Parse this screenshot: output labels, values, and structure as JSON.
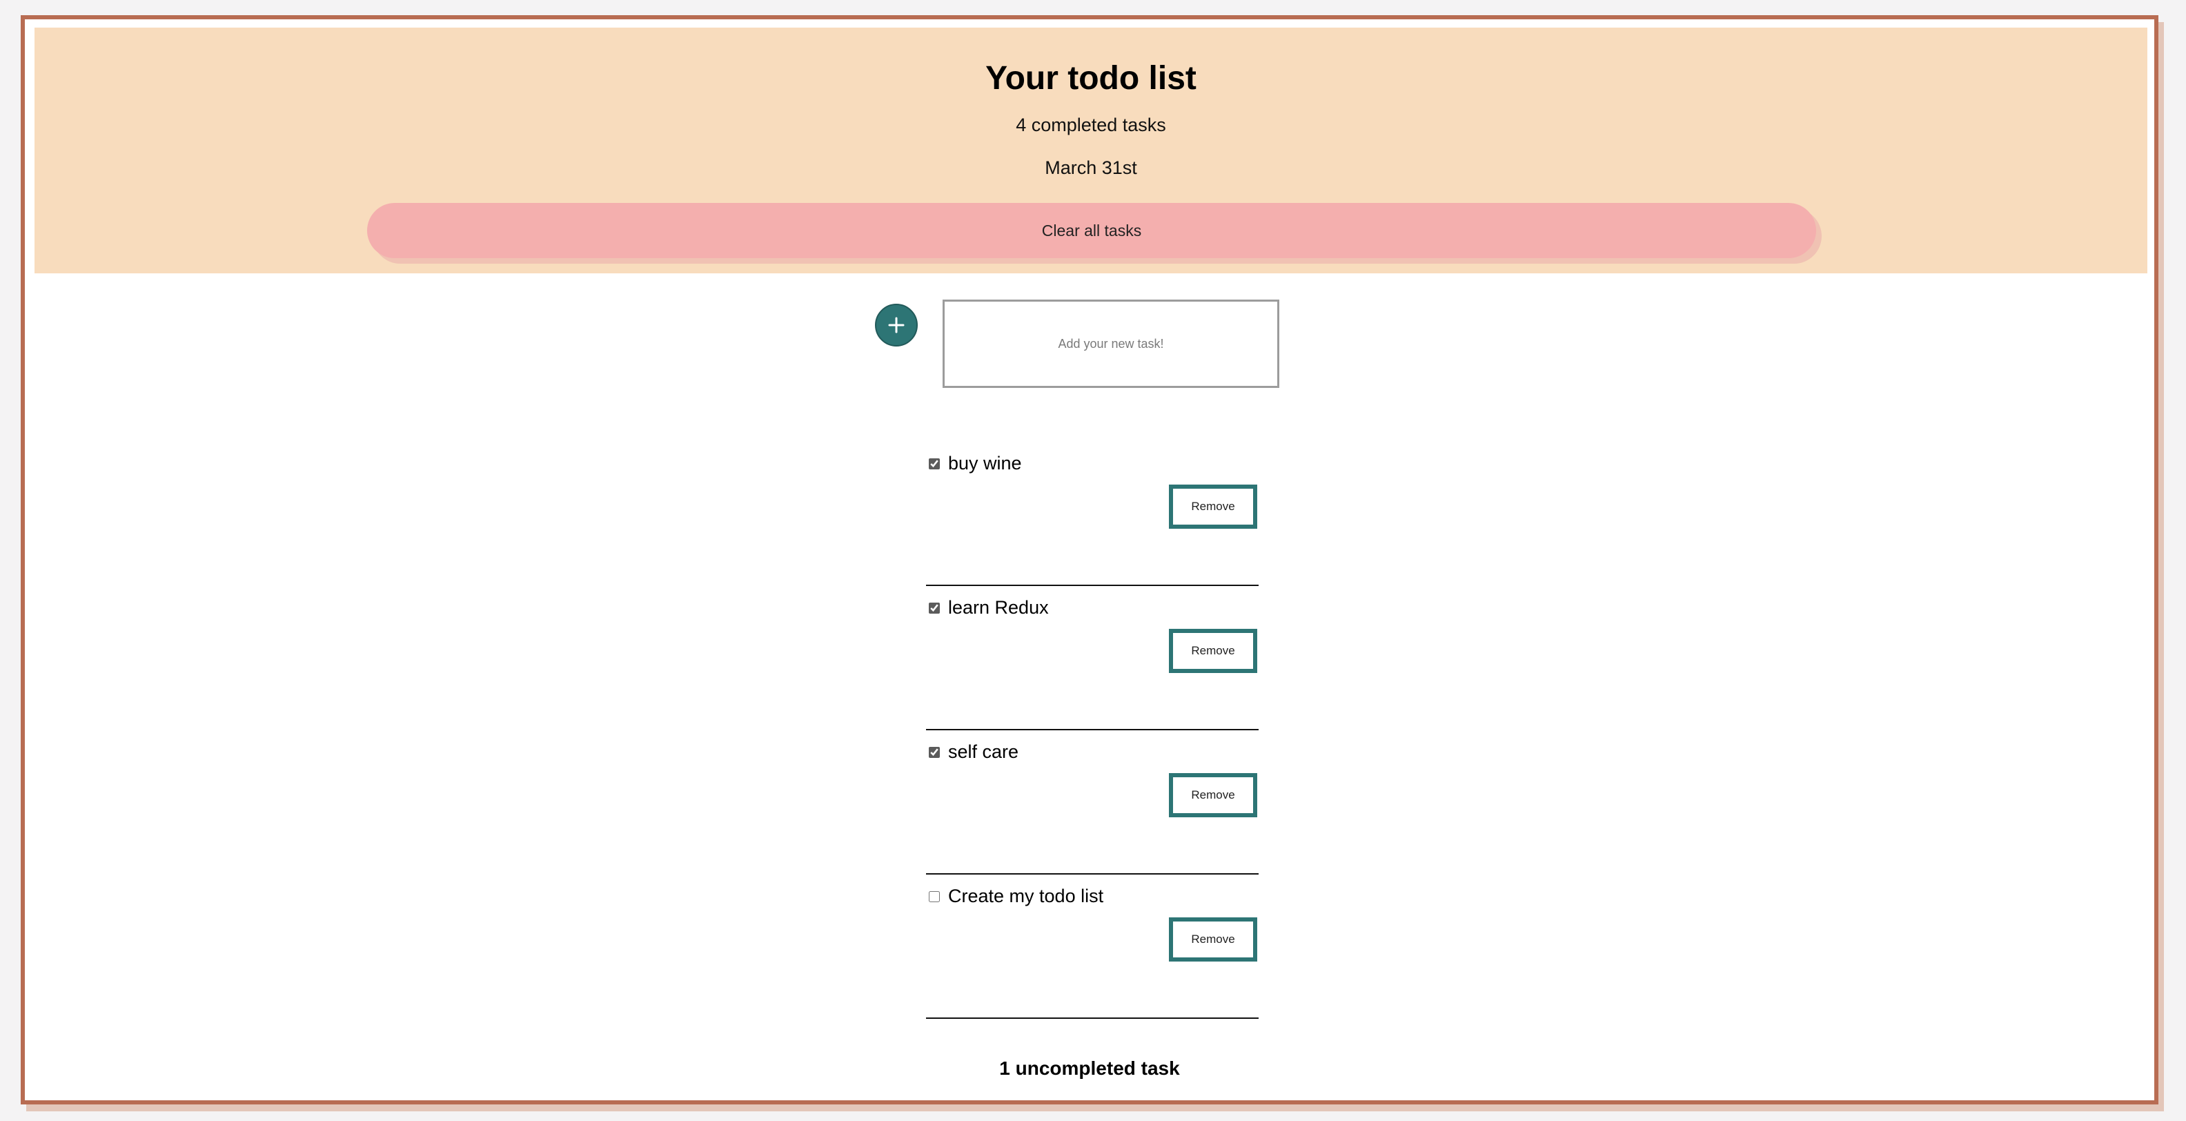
{
  "header": {
    "title": "Your todo list",
    "completed_count": "4 completed tasks",
    "date": "March 31st",
    "clear_button_label": "Clear all tasks"
  },
  "new_task": {
    "placeholder": "Add your new task!",
    "add_icon": "plus-icon"
  },
  "colors": {
    "header_background": "#f8dcbd",
    "clear_button": "#f4afae",
    "accent_teal": "#2d7575",
    "frame_border": "#b86c52"
  },
  "tasks": [
    {
      "label": "buy wine",
      "checked": true,
      "remove_label": "Remove"
    },
    {
      "label": "learn Redux",
      "checked": true,
      "remove_label": "Remove"
    },
    {
      "label": "self care",
      "checked": true,
      "remove_label": "Remove"
    },
    {
      "label": "Create my todo list",
      "checked": false,
      "remove_label": "Remove"
    }
  ],
  "footer": {
    "uncompleted_count": "1 uncompleted task"
  }
}
